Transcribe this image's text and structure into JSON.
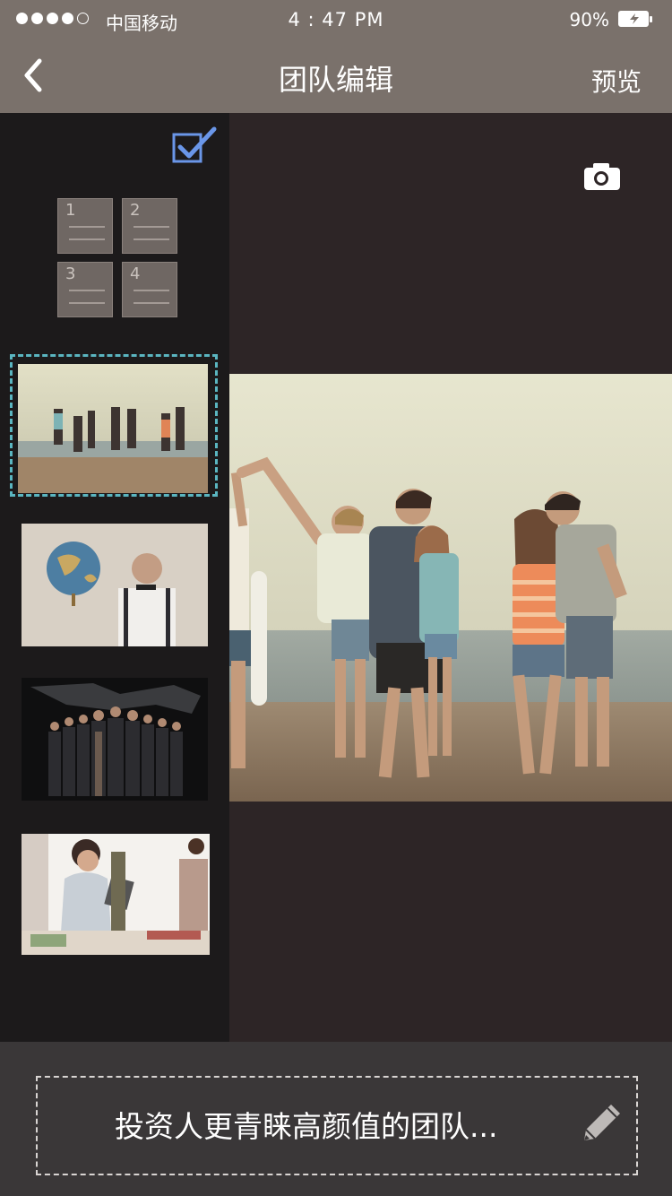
{
  "status_bar": {
    "signal_dots": 5,
    "signal_filled": 4,
    "carrier": "中国移动",
    "time": "4 : 47 PM",
    "battery": "90%"
  },
  "nav": {
    "back_icon": "chevron-left-icon",
    "title": "团队编辑",
    "preview_label": "预览"
  },
  "left_panel": {
    "select_icon": "checkbox-checked-icon",
    "layout_cells": [
      "1",
      "2",
      "3",
      "4"
    ],
    "thumbnails": [
      {
        "name": "beach-group-photo",
        "selected": true
      },
      {
        "name": "man-with-globe-photo",
        "selected": false
      },
      {
        "name": "business-team-photo",
        "selected": false
      },
      {
        "name": "women-workshop-photo",
        "selected": false
      }
    ]
  },
  "main": {
    "camera_icon": "camera-icon",
    "photo": "beach-group-photo"
  },
  "bottom": {
    "caption": "投资人更青睐高颜值的团队...",
    "edit_icon": "pencil-icon"
  },
  "colors": {
    "header": "#7a716b",
    "left_panel": "#1c1a1b",
    "main_bg": "#2d2526",
    "bottom_bar": "#3a3738",
    "selection_dash": "#5ab5c0",
    "check_accent": "#6a96e8"
  }
}
